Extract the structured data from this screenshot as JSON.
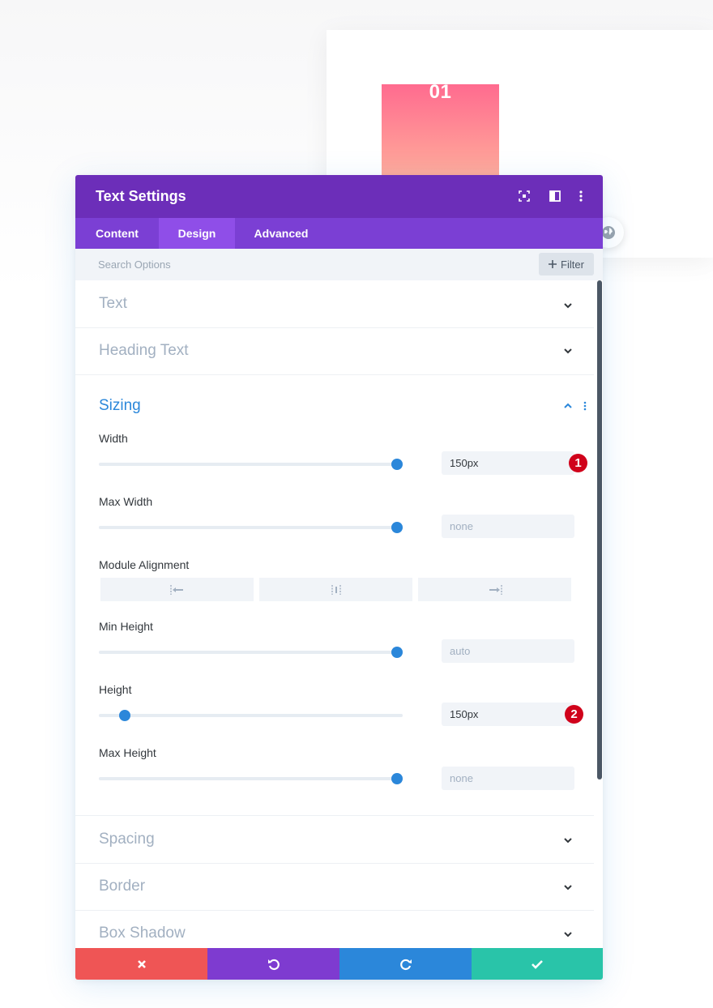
{
  "preview": {
    "number": "01"
  },
  "modal": {
    "title": "Text Settings",
    "tabs": [
      {
        "label": "Content"
      },
      {
        "label": "Design"
      },
      {
        "label": "Advanced"
      }
    ],
    "active_tab": "Design",
    "search": {
      "placeholder": "Search Options"
    },
    "filter_label": "Filter",
    "sections": {
      "text": "Text",
      "heading_text": "Heading Text",
      "sizing": "Sizing",
      "spacing": "Spacing",
      "border": "Border",
      "box_shadow": "Box Shadow"
    },
    "sizing": {
      "width": {
        "label": "Width",
        "value": "150px",
        "badge": "1",
        "slider": 1.0
      },
      "max_width": {
        "label": "Max Width",
        "placeholder": "none",
        "slider": 1.0
      },
      "module_alignment": {
        "label": "Module Alignment",
        "options": [
          "left",
          "center",
          "right"
        ]
      },
      "min_height": {
        "label": "Min Height",
        "placeholder": "auto",
        "slider": 1.0
      },
      "height": {
        "label": "Height",
        "value": "150px",
        "badge": "2",
        "slider": 0.07
      },
      "max_height": {
        "label": "Max Height",
        "placeholder": "none",
        "slider": 1.0
      }
    },
    "footer": {
      "cancel_color": "#ef5555",
      "undo_color": "#7e3bd0",
      "redo_color": "#2b87da",
      "save_color": "#29c4a9"
    }
  },
  "colors": {
    "header": "#6c2eb9",
    "tabs": "#7b3fd4",
    "accent": "#2b87da",
    "badge": "#d0021b"
  }
}
